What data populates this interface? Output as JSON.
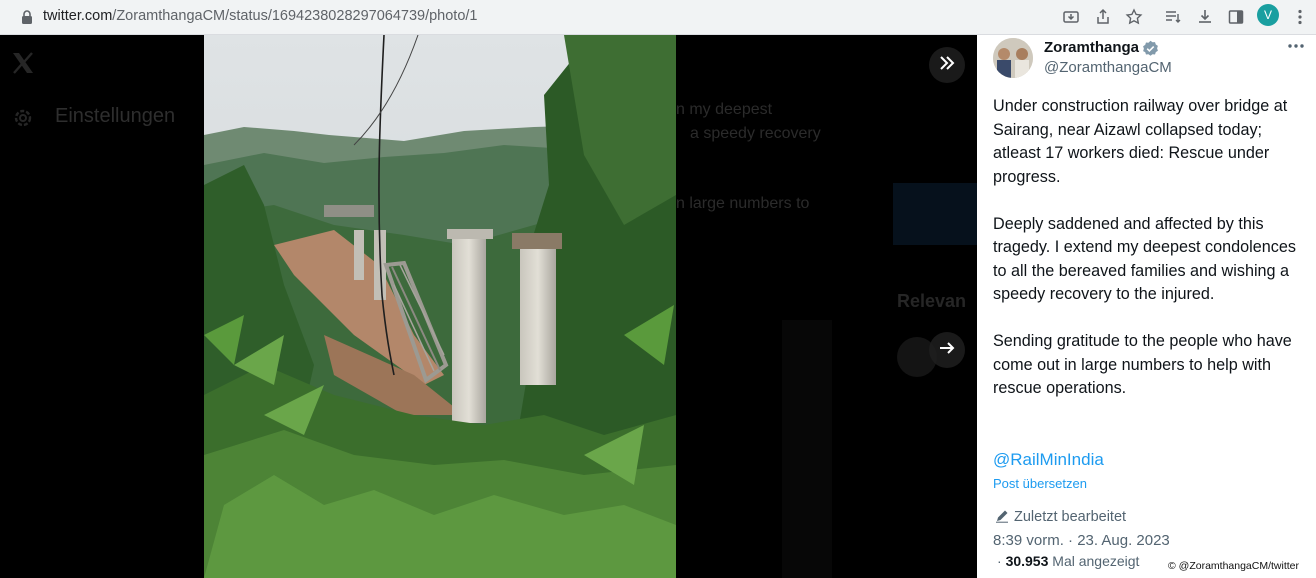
{
  "browser": {
    "url_host": "twitter.com",
    "url_path": "/ZoramthangaCM/status/1694238028297064739/photo/1",
    "profile_initial": "V",
    "profile_color": "#1a9fa0"
  },
  "background": {
    "settings_label": "Einstellungen",
    "ghost_lines": [
      "n my deepest",
      "a speedy recovery",
      "n large numbers to"
    ],
    "relevant_heading": "Relevan"
  },
  "tweet": {
    "author_name": "Zoramthanga",
    "handle": "@ZoramthangaCM",
    "body": "Under construction railway over bridge at  Sairang, near Aizawl collapsed today; atleast 17 workers died: Rescue under progress.\n\nDeeply saddened and affected by this tragedy. I extend my deepest condolences to all the bereaved families and wishing a speedy recovery to the injured.\n\nSending gratitude to the people who have come out in large numbers to help with rescue operations.",
    "mention": "@RailMinIndia",
    "translate_label": "Post übersetzen",
    "edited_label": "Zuletzt bearbeitet",
    "timestamp": "8:39 vorm. · 23. Aug. 2023",
    "views_prefix": "· ",
    "views_count": "30.953",
    "views_label": " Mal angezeigt"
  },
  "credit": "© @ZoramthangaCM/twitter",
  "icons": {
    "lock": "lock-icon",
    "verified": "verified-badge-icon",
    "more": "more-options-icon",
    "expand": "double-chevron-right-icon",
    "next": "arrow-right-icon",
    "edit": "pencil-icon"
  },
  "colors": {
    "accent": "#1d9bf0",
    "text": "#0f1419",
    "secondary": "#536471"
  }
}
